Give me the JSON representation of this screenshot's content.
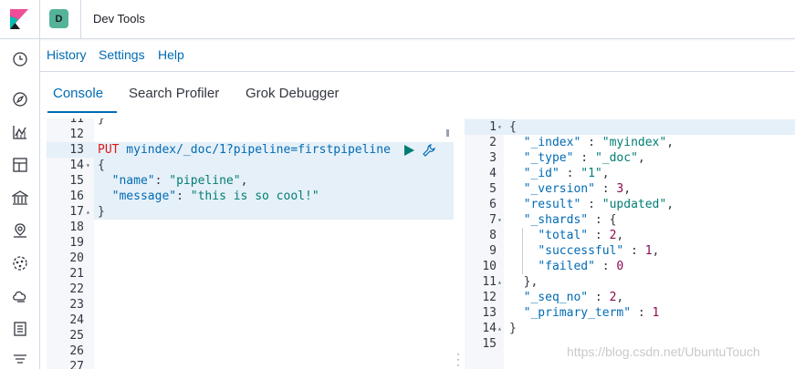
{
  "header": {
    "avatar_letter": "D",
    "title": "Dev Tools"
  },
  "top_links": [
    "History",
    "Settings",
    "Help"
  ],
  "tabs": [
    "Console",
    "Search Profiler",
    "Grok Debugger"
  ],
  "colors": {
    "accent": "#006bb4",
    "avatar_bg": "#54b399",
    "keyword": "#d91a1a",
    "string": "#017d73"
  },
  "left_nav_icons": [
    "clock-icon",
    "compass-icon",
    "visualize-icon",
    "dashboard-icon",
    "canvas-icon",
    "maps-icon",
    "ml-icon",
    "infra-icon",
    "logs-icon",
    "apm-icon"
  ],
  "editor": {
    "partial_top": {
      "num": "11",
      "code": "}"
    },
    "lines": [
      {
        "num": "12",
        "code": ""
      },
      {
        "num": "13",
        "method": "PUT",
        "path": " myindex/_doc/1?pipeline=firstpipeline"
      },
      {
        "num": "14",
        "code": "{",
        "fold": "▾"
      },
      {
        "num": "15",
        "key": "\"name\"",
        "rest": ": ",
        "str": "\"pipeline\"",
        "tail": ","
      },
      {
        "num": "16",
        "key": "\"message\"",
        "rest": ": ",
        "str": "\"this is so cool!\"",
        "tail": ""
      },
      {
        "num": "17",
        "code": "}",
        "fold": "▴"
      },
      {
        "num": "18",
        "code": ""
      },
      {
        "num": "19",
        "code": ""
      },
      {
        "num": "20",
        "code": ""
      },
      {
        "num": "21",
        "code": ""
      },
      {
        "num": "22",
        "code": ""
      },
      {
        "num": "23",
        "code": ""
      },
      {
        "num": "24",
        "code": ""
      },
      {
        "num": "25",
        "code": ""
      },
      {
        "num": "26",
        "code": ""
      },
      {
        "num": "27",
        "code": ""
      }
    ]
  },
  "output": {
    "lines": [
      {
        "num": "1",
        "fold": "▾",
        "code": "{"
      },
      {
        "num": "2",
        "k": "\"_index\"",
        "s": "\"myindex\"",
        "t": ","
      },
      {
        "num": "3",
        "k": "\"_type\"",
        "s": "\"_doc\"",
        "t": ","
      },
      {
        "num": "4",
        "k": "\"_id\"",
        "s": "\"1\"",
        "t": ","
      },
      {
        "num": "5",
        "k": "\"_version\"",
        "n": "3",
        "t": ","
      },
      {
        "num": "6",
        "k": "\"result\"",
        "s": "\"updated\"",
        "t": ","
      },
      {
        "num": "7",
        "fold": "▾",
        "k": "\"_shards\"",
        "c": " {"
      },
      {
        "num": "8",
        "k": "\"total\"",
        "n": "2",
        "t": ",",
        "deep": true
      },
      {
        "num": "9",
        "k": "\"successful\"",
        "n": "1",
        "t": ",",
        "deep": true
      },
      {
        "num": "10",
        "k": "\"failed\"",
        "n": "0",
        "t": "",
        "deep": true
      },
      {
        "num": "11",
        "fold": "▴",
        "code": "  },"
      },
      {
        "num": "12",
        "k": "\"_seq_no\"",
        "n": "2",
        "t": ","
      },
      {
        "num": "13",
        "k": "\"_primary_term\"",
        "n": "1",
        "t": ""
      },
      {
        "num": "14",
        "fold": "▴",
        "code": "}"
      },
      {
        "num": "15",
        "code": ""
      }
    ]
  },
  "watermark": "https://blog.csdn.net/UbuntuTouch"
}
